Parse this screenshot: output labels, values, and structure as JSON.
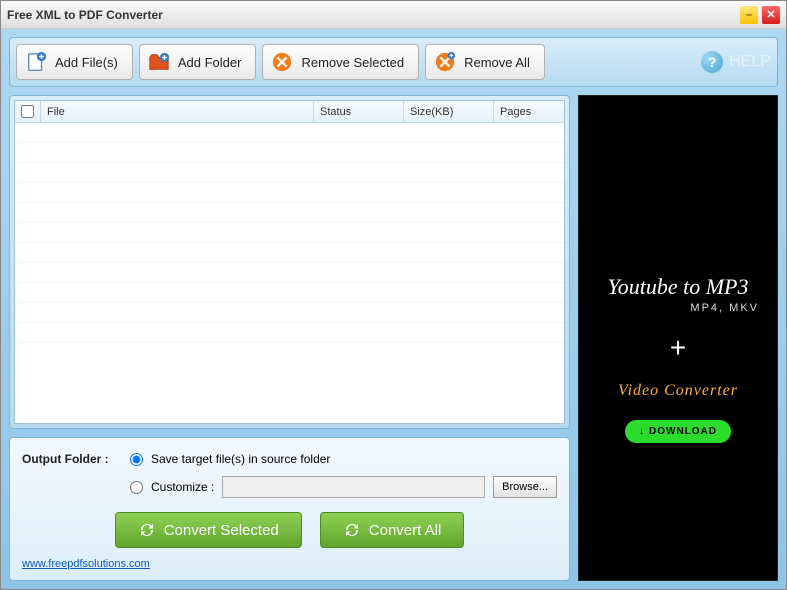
{
  "window": {
    "title": "Free XML to PDF Converter"
  },
  "toolbar": {
    "add_files": "Add File(s)",
    "add_folder": "Add Folder",
    "remove_selected": "Remove Selected",
    "remove_all": "Remove All",
    "help": "HELP"
  },
  "table": {
    "headers": {
      "file": "File",
      "status": "Status",
      "size": "Size(KB)",
      "pages": "Pages"
    }
  },
  "output": {
    "label": "Output Folder :",
    "opt_source": "Save target file(s) in source folder",
    "opt_custom": "Customize :",
    "browse": "Browse...",
    "custom_path": "",
    "convert_selected": "Convert Selected",
    "convert_all": "Convert All",
    "link": "www.freepdfsolutions.com"
  },
  "ad": {
    "title": "Youtube to MP3",
    "subtitle": "MP4, MKV",
    "plus": "+",
    "vc": "Video Converter",
    "download": "DOWNLOAD"
  }
}
